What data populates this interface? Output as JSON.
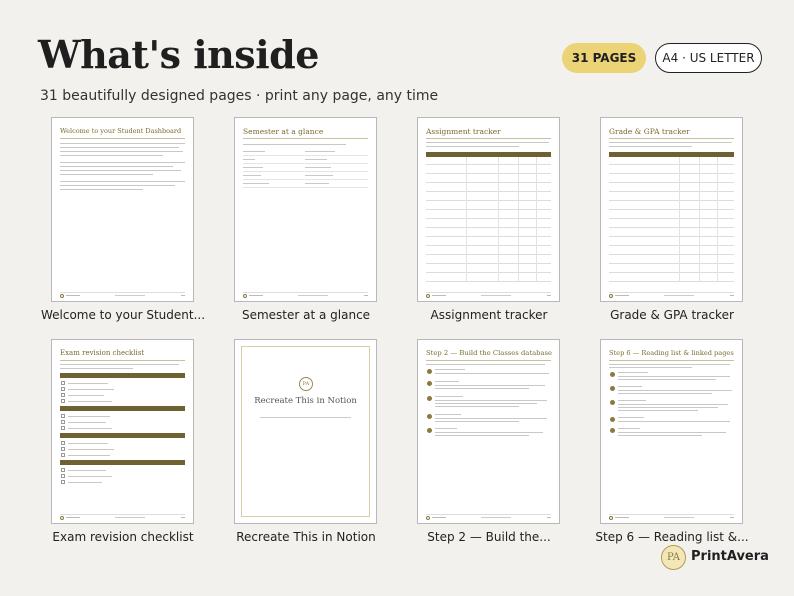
{
  "header": {
    "title": "What's inside",
    "subtitle": "31 beautifully designed pages · print any page, any time",
    "badge_pages": "31 PAGES",
    "badge_size": "A4 · US LETTER"
  },
  "colors": {
    "accent_gold": "#ecd476",
    "olive": "#6e6132",
    "background": "#f2f1ee"
  },
  "pages": [
    {
      "title": "Welcome to your Student Dashboard",
      "caption": "Welcome to your Student..."
    },
    {
      "title": "Semester at a glance",
      "caption": "Semester at a glance"
    },
    {
      "title": "Assignment tracker",
      "caption": "Assignment tracker"
    },
    {
      "title": "Grade & GPA tracker",
      "caption": "Grade & GPA tracker"
    },
    {
      "title": "Exam revision checklist",
      "caption": "Exam revision checklist"
    },
    {
      "title": "Recreate This in Notion",
      "caption": "Recreate This in Notion",
      "logo": "PA"
    },
    {
      "title": "Step 2 — Build the Classes database",
      "caption": "Step 2 — Build the..."
    },
    {
      "title": "Step 6 — Reading list & linked pages",
      "caption": "Step 6 — Reading list &..."
    }
  ],
  "brand": {
    "logo": "PA",
    "name": "PrintAvera"
  }
}
